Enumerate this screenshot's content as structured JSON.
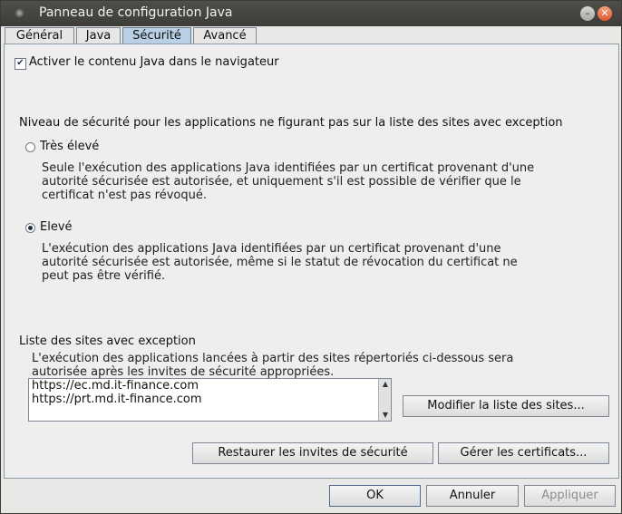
{
  "window": {
    "title": "Panneau de configuration Java"
  },
  "tabs": [
    {
      "label": "Général"
    },
    {
      "label": "Java"
    },
    {
      "label": "Sécurité"
    },
    {
      "label": "Avancé"
    }
  ],
  "security": {
    "enable_java_label": "Activer le contenu Java dans le navigateur",
    "enable_java_checked": true,
    "level_heading": "Niveau de sécurité pour les applications ne figurant pas sur la liste des sites avec exception",
    "options": [
      {
        "label": "Très élevé",
        "selected": false,
        "description": "Seule l'exécution des applications Java identifiées par un certificat provenant d'une\nautorité sécurisée est autorisée, et uniquement s'il est possible de vérifier que le\ncertificat n'est pas révoqué."
      },
      {
        "label": "Elevé",
        "selected": true,
        "description": "L'exécution des applications Java identifiées par un certificat provenant d'une\nautorité sécurisée est autorisée, même si le statut de révocation du certificat ne\npeut pas être vérifié."
      }
    ],
    "exception_heading": "Liste des sites avec exception",
    "exception_description": "L'exécution des applications lancées à partir des sites répertoriés ci-dessous sera\nautorisée après les invites de sécurité appropriées.",
    "sites": [
      "https://ec.md.it-finance.com",
      "https://prt.md.it-finance.com"
    ],
    "edit_sites_button": "Modifier la liste des sites...",
    "restore_prompts_button": "Restaurer les invites de sécurité",
    "manage_certs_button": "Gérer les certificats..."
  },
  "footer": {
    "ok": "OK",
    "cancel": "Annuler",
    "apply": "Appliquer"
  },
  "icons": {
    "checkbox": "check-mark",
    "scroll_up": "triangle-up",
    "scroll_down": "triangle-down"
  }
}
